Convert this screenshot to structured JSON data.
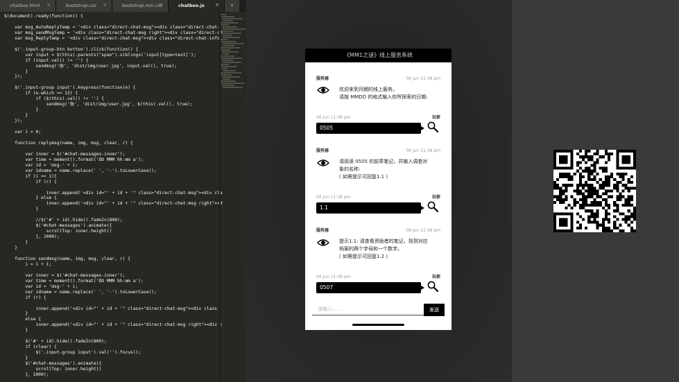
{
  "editor": {
    "tabs": [
      {
        "label": "chatbox.html",
        "active": false
      },
      {
        "label": "bootstrap.css",
        "active": false
      },
      {
        "label": "bootstrap.min.css",
        "active": false
      },
      {
        "label": "chatbox.js",
        "active": true
      }
    ],
    "close_glyph": "×",
    "tab_scroll_glyph": "▾",
    "code_lines": [
      "$(document).ready(function() {",
      "",
      "    var msg_AutoReplyTemp = '<div class=\"direct-chat-msg\"><div class=\"direct-chat-",
      "    var msg_sendMsgTemp = '<div class=\"direct-chat-msg right\"><div class=\"direct-ch",
      "    var msg_ReplyTemp = '<div class=\"direct-chat-msg\"><div class=\"direct-chat-info",
      "",
      "    $('.input-group-btn button').click(function() {",
      "        var input = $(this).parents(\"span\").siblings('input[type=text]');",
      "        if (input.val() != '') {",
      "            sendmsg('你', 'dist/img/user.jpg', input.val(), true);",
      "        }",
      "    });",
      "",
      "    $('.input-group input').keypress(function(e) {",
      "        if (e.which == 13) {",
      "            if ($(this).val() != '') {",
      "                sendmsg('你', 'dist/img/user.jpg', $(this).val(), true);",
      "            }",
      "        }",
      "    });",
      "",
      "    var i = 0;",
      "",
      "    function replymsg(name, img, msg, clear, r) {",
      "",
      "        var inner = $('#chat-messages-inner');",
      "        var time = moment().format('DD MMM hh:mm a');",
      "        var id = 'msg-' + i;",
      "        var idname = name.replace(' ', '-').toLowerCase();",
      "        if (i == 1){",
      "            if (r) {",
      "",
      "                inner.append('<div id=\"' + id + '\" class=\"direct-chat-msg\"><div cla",
      "            } else {",
      "                inner.append('<div id=\"' + id + '\" class=\"direct-chat-msg right\"><d",
      "            }",
      "",
      "            //$('#' + id).hide().fadeIn(800);",
      "            $('#chat-messages').animate({",
      "                scrollTop: inner.height()",
      "            }, 1000);",
      "        }",
      "    }",
      "",
      "    function sendmsg(name, img, msg, clear, r) {",
      "        i = i + 1;",
      "",
      "        var inner = $('#chat-messages-inner');",
      "        var time = moment().format('DD MMM hh:mm a');",
      "        var id = 'msg-' + i;",
      "        var idname = name.replace(' ', '-').toLowerCase();",
      "        if (r) {",
      "",
      "            inner.append('<div id=\"' + id + '\" class=\"direct-chat-msg\"><div class",
      "        }",
      "        else {",
      "            inner.append('<div id=\"' + id + '\" class=\"direct-chat-msg right\"><div c",
      "        }",
      "",
      "        $('#' + id).hide().fadeIn(800);",
      "        if (clear) {",
      "            $('.input-group input').val('').focus();",
      "        }",
      "        $('#chat-messages').animate({",
      "            scrollTop: inner.height()",
      "        }, 1000);"
    ]
  },
  "chat": {
    "title": "《MM1之谜》线上服务系统",
    "messages": [
      {
        "side": "left",
        "name": "服务器",
        "time": "06 Jun 11:38 pm",
        "text": "欢迎来到月朗的线上服务。\n请按 MMDD 的格式输入你所探索的日期:"
      },
      {
        "side": "right",
        "name": "玩家",
        "time": "06 Jun 11:38 pm",
        "text": "0505"
      },
      {
        "side": "left",
        "name": "服务器",
        "time": "06 Jun 11:38 pm",
        "text": "请阅读 0505 的前章笔记，并输入调查对\n象的名称:\n( 如需提示可回复1.1 )"
      },
      {
        "side": "right",
        "name": "玩家",
        "time": "06 Jun 11:38 pm",
        "text": "1.1"
      },
      {
        "side": "left",
        "name": "服务器",
        "time": "06 Jun 11:38 pm",
        "text": "提示1.1: 请查看资助者的笔记，找到对应\n档案的两个字母和一个数字。\n( 如需提示可回复1.2 )"
      },
      {
        "side": "right",
        "name": "玩家",
        "time": "06 Jun 11:39 pm",
        "text": "0507"
      }
    ],
    "input_placeholder": "请输入……",
    "send_label": "发送"
  },
  "colors": {
    "editor_bg": "#272822",
    "chat_header": "#000000",
    "bubble": "#000000",
    "page_bg": "#2b2b2b"
  },
  "icons": {
    "left_avatar": "eye-icon",
    "right_avatar": "magnifier-icon"
  }
}
